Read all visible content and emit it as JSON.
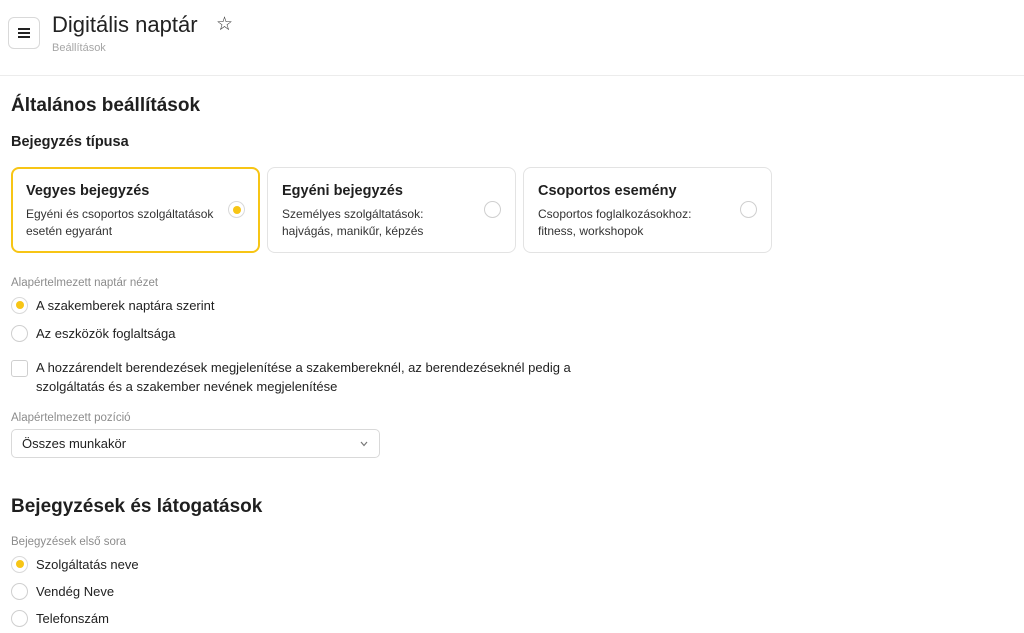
{
  "header": {
    "title": "Digitális naptár",
    "breadcrumb": "Beállítások",
    "star_icon": "☆"
  },
  "general": {
    "heading": "Általános beállítások",
    "entry_type": {
      "label": "Bejegyzés típusa",
      "cards": [
        {
          "title": "Vegyes bejegyzés",
          "desc": "Egyéni és csoportos szolgáltatások esetén egyaránt",
          "selected": true
        },
        {
          "title": "Egyéni bejegyzés",
          "desc": "Személyes szolgáltatások: hajvágás, manikűr, képzés",
          "selected": false
        },
        {
          "title": "Csoportos esemény",
          "desc": "Csoportos foglalkozásokhoz: fitness, workshopok",
          "selected": false
        }
      ]
    },
    "default_view": {
      "label": "Alapértelmezett naptár nézet",
      "options": [
        {
          "label": "A szakemberek naptára szerint",
          "selected": true
        },
        {
          "label": "Az eszközök foglaltsága",
          "selected": false
        }
      ]
    },
    "show_equipment": {
      "label": "A hozzárendelt berendezések megjelenítése a szakembereknél, az berendezéseknél pedig a szolgáltatás és a szakember nevének megjelenítése",
      "checked": false
    },
    "default_position": {
      "label": "Alapértelmezett pozíció",
      "value": "Összes munkakör"
    }
  },
  "entries": {
    "heading": "Bejegyzések és látogatások",
    "first_row": {
      "label": "Bejegyzések első sora",
      "options": [
        {
          "label": "Szolgáltatás neve",
          "selected": true
        },
        {
          "label": "Vendég Neve",
          "selected": false
        },
        {
          "label": "Telefonszám",
          "selected": false
        }
      ]
    }
  },
  "colors": {
    "accent": "#f7c515",
    "border": "#e3e3e3"
  }
}
